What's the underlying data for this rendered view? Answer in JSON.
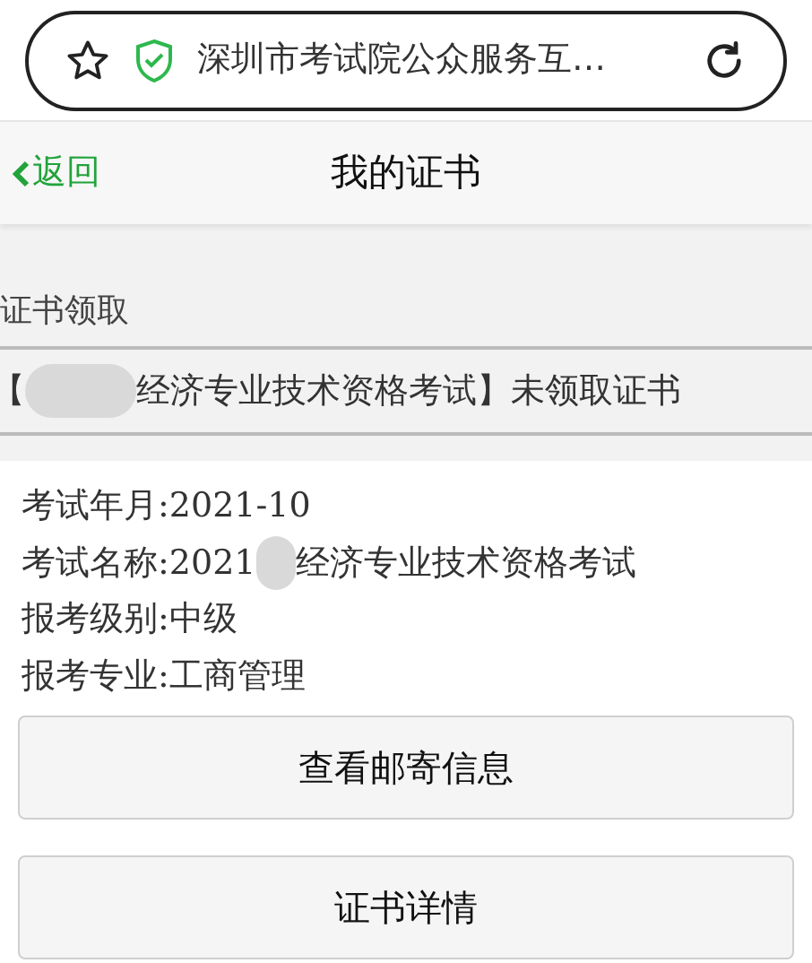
{
  "browser": {
    "address": "深圳市考试院公众服务互…"
  },
  "nav": {
    "back": "返回",
    "title": "我的证书"
  },
  "section": {
    "title": "证书领取",
    "notice": [
      {
        "kind": "text",
        "text": "【"
      },
      {
        "kind": "redacted"
      },
      {
        "kind": "text",
        "text": "经济专业技术资格考试】未领取证书"
      }
    ]
  },
  "details": [
    [
      {
        "kind": "text",
        "text": "考试年月:2021-10"
      }
    ],
    [
      {
        "kind": "text",
        "text": "考试名称:2021"
      },
      {
        "kind": "redacted"
      },
      {
        "kind": "text",
        "text": "经济专业技术资格考试"
      }
    ],
    [
      {
        "kind": "text",
        "text": "报考级别:中级"
      }
    ],
    [
      {
        "kind": "text",
        "text": "报考专业:工商管理"
      }
    ]
  ],
  "buttons": [
    "查看邮寄信息",
    "证书详情"
  ]
}
